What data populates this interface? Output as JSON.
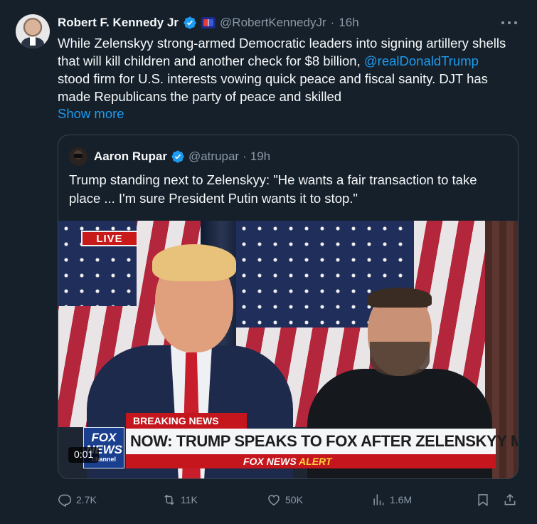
{
  "author": {
    "name": "Robert F. Kennedy Jr",
    "handle": "@RobertKennedyJr",
    "time": "16h"
  },
  "tweet": {
    "text_before_mention": "While Zelenskyy strong-armed Democratic leaders into signing artillery shells that will kill children and another check for $8 billion, ",
    "mention": "@realDonaldTrump",
    "text_after_mention": " stood firm for U.S. interests vowing quick peace and fiscal sanity. DJT has made Republicans the party of peace and skilled",
    "show_more": "Show more"
  },
  "quote": {
    "name": "Aaron Rupar",
    "handle": "@atrupar",
    "time": "19h",
    "text": "Trump standing next to Zelenskyy: \"He wants a fair transaction to take place ... I'm sure President Putin wants it to stop.\"",
    "video": {
      "live_label": "LIVE",
      "breaking": "BREAKING NEWS",
      "headline": "NOW: TRUMP SPEAKS TO FOX AFTER ZELENSKYY MEETING",
      "alert_prefix": "FOX NEWS",
      "alert_word": "ALERT",
      "logo_line1": "FOX",
      "logo_line2": "NEWS",
      "logo_line3": "channel",
      "timestamp": "0:01"
    }
  },
  "actions": {
    "replies": "2.7K",
    "reposts": "11K",
    "likes": "50K",
    "views": "1.6M"
  },
  "colors": {
    "background": "#15202b",
    "accent": "#1d9bf0",
    "muted": "#8b98a5"
  },
  "icons": [
    "verified-badge-icon",
    "affiliate-badge-icon",
    "more-options-icon",
    "reply-icon",
    "repost-icon",
    "like-icon",
    "views-icon",
    "bookmark-icon",
    "share-icon"
  ]
}
